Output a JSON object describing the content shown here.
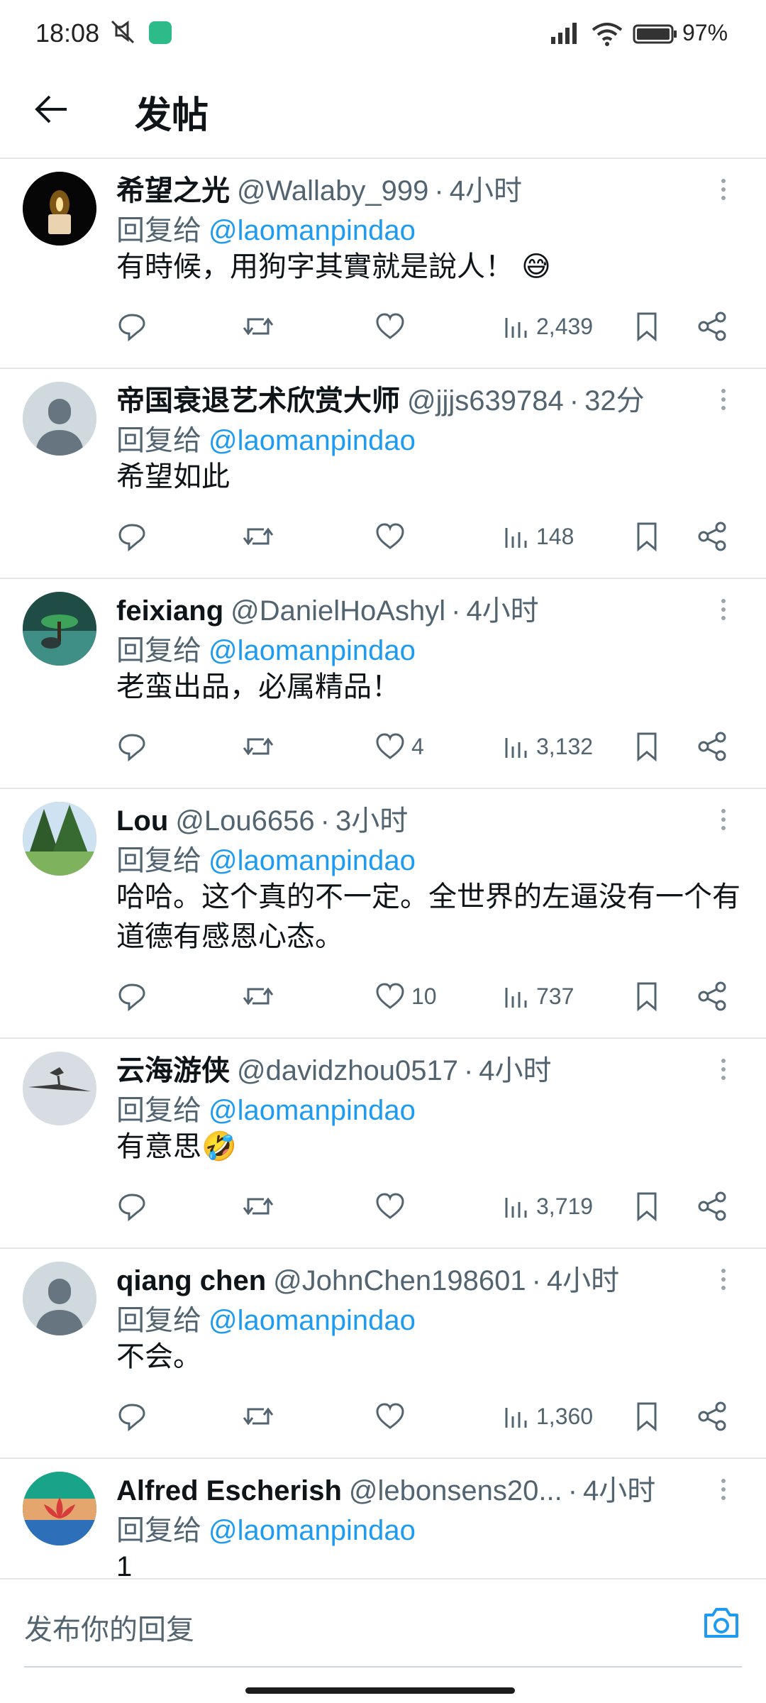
{
  "status": {
    "time": "18:08",
    "battery": "97%",
    "icons": [
      "mute-icon",
      "app-shield-icon",
      "signal-icon",
      "wifi-icon",
      "battery-icon"
    ]
  },
  "header": {
    "title": "发帖",
    "back_icon": "arrow-left-icon"
  },
  "tweets": [
    {
      "name": "希望之光",
      "handle": "@Wallaby_999",
      "age": "4小时",
      "reply_prefix": "回复给",
      "reply_to": "@laomanpindao",
      "text": "有時候，用狗字其實就是說人！ 😅",
      "likes": "",
      "views": "2,439"
    },
    {
      "name": "帝国衰退艺术欣赏大师",
      "handle": "@jjjs639784",
      "age": "32分",
      "reply_prefix": "回复给",
      "reply_to": "@laomanpindao",
      "text": "希望如此",
      "likes": "",
      "views": "148"
    },
    {
      "name": "feixiang",
      "handle": "@DanielHoAshyl",
      "age": "4小时",
      "reply_prefix": "回复给",
      "reply_to": "@laomanpindao",
      "text": "老蛮出品，必属精品！",
      "likes": "4",
      "views": "3,132"
    },
    {
      "name": "Lou",
      "handle": "@Lou6656",
      "age": "3小时",
      "reply_prefix": "回复给",
      "reply_to": "@laomanpindao",
      "text": "哈哈。这个真的不一定。全世界的左逼没有一个有道德有感恩心态。",
      "likes": "10",
      "views": "737"
    },
    {
      "name": "云海游侠",
      "handle": "@davidzhou0517",
      "age": "4小时",
      "reply_prefix": "回复给",
      "reply_to": "@laomanpindao",
      "text": "有意思🤣",
      "likes": "",
      "views": "3,719"
    },
    {
      "name": "qiang chen",
      "handle": "@JohnChen198601",
      "age": "4小时",
      "reply_prefix": "回复给",
      "reply_to": "@laomanpindao",
      "text": "不会。",
      "likes": "",
      "views": "1,360"
    },
    {
      "name": "Alfred Escherish",
      "handle": "@lebonsens20...",
      "age": "4小时",
      "reply_prefix": "回复给",
      "reply_to": "@laomanpindao",
      "text": "1",
      "likes": "",
      "views": ""
    }
  ],
  "composer": {
    "placeholder": "发布你的回复",
    "camera_icon": "camera-icon"
  },
  "colors": {
    "accent": "#1d9bf0",
    "muted": "#536471",
    "divider": "#e6e6e6"
  }
}
